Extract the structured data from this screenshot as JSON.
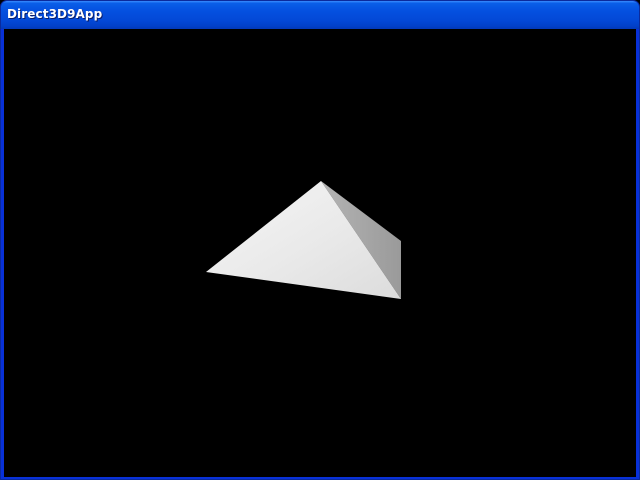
{
  "window": {
    "title": "Direct3D9App"
  },
  "scene": {
    "object": "pyramid",
    "background_color": "#000000",
    "lit_face_color": "#f2f2f2",
    "side_face_color": "#a9a9a9"
  },
  "colors": {
    "titlebar_blue": "#0552e1",
    "frame_blue": "#0831d9"
  }
}
